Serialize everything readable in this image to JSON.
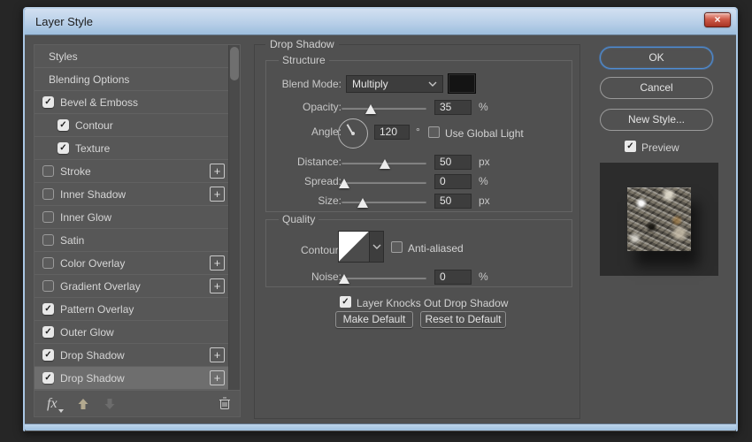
{
  "window": {
    "title": "Layer Style"
  },
  "icons": {
    "check": "✓",
    "close": "×",
    "plus": "+",
    "fx": "fx",
    "up_arrow": "move-up",
    "down_arrow": "move-down",
    "trash": "delete-effect"
  },
  "colors": {
    "accent_blue": "#4f8ed6",
    "titlebar_top": "#d2e0f1",
    "titlebar_bottom": "#9dbedd",
    "swatch_black": "#141414",
    "close_red": "#cf5c4a",
    "selected_row": "#6e6e6e"
  },
  "sidebar": {
    "items": [
      {
        "label": "Styles",
        "checked": null,
        "plus": false,
        "indent": false,
        "selected": false
      },
      {
        "label": "Blending Options",
        "checked": null,
        "plus": false,
        "indent": false,
        "selected": false
      },
      {
        "label": "Bevel & Emboss",
        "checked": true,
        "plus": false,
        "indent": false,
        "selected": false
      },
      {
        "label": "Contour",
        "checked": true,
        "plus": false,
        "indent": true,
        "selected": false
      },
      {
        "label": "Texture",
        "checked": true,
        "plus": false,
        "indent": true,
        "selected": false
      },
      {
        "label": "Stroke",
        "checked": false,
        "plus": true,
        "indent": false,
        "selected": false
      },
      {
        "label": "Inner Shadow",
        "checked": false,
        "plus": true,
        "indent": false,
        "selected": false
      },
      {
        "label": "Inner Glow",
        "checked": false,
        "plus": false,
        "indent": false,
        "selected": false
      },
      {
        "label": "Satin",
        "checked": false,
        "plus": false,
        "indent": false,
        "selected": false
      },
      {
        "label": "Color Overlay",
        "checked": false,
        "plus": true,
        "indent": false,
        "selected": false
      },
      {
        "label": "Gradient Overlay",
        "checked": false,
        "plus": true,
        "indent": false,
        "selected": false
      },
      {
        "label": "Pattern Overlay",
        "checked": true,
        "plus": false,
        "indent": false,
        "selected": false
      },
      {
        "label": "Outer Glow",
        "checked": true,
        "plus": false,
        "indent": false,
        "selected": false
      },
      {
        "label": "Drop Shadow",
        "checked": true,
        "plus": true,
        "indent": false,
        "selected": false
      },
      {
        "label": "Drop Shadow",
        "checked": true,
        "plus": true,
        "indent": false,
        "selected": true
      }
    ]
  },
  "main": {
    "panel_title": "Drop Shadow",
    "structure": {
      "legend": "Structure",
      "blend_mode": {
        "label": "Blend Mode:",
        "value": "Multiply"
      },
      "opacity": {
        "label": "Opacity:",
        "value": "35",
        "unit": "%",
        "pos": 34
      },
      "angle": {
        "label": "Angle:",
        "value": "120",
        "unit": "°"
      },
      "use_global_light": {
        "label": "Use Global Light",
        "checked": false
      },
      "distance": {
        "label": "Distance:",
        "value": "50",
        "unit": "px",
        "pos": 51
      },
      "spread": {
        "label": "Spread:",
        "value": "0",
        "unit": "%",
        "pos": 3
      },
      "size": {
        "label": "Size:",
        "value": "50",
        "unit": "px",
        "pos": 25
      }
    },
    "quality": {
      "legend": "Quality",
      "contour": {
        "label": "Contour:"
      },
      "anti_aliased": {
        "label": "Anti-aliased",
        "checked": false
      },
      "noise": {
        "label": "Noise:",
        "value": "0",
        "unit": "%",
        "pos": 3
      }
    },
    "knockout": {
      "label": "Layer Knocks Out Drop Shadow",
      "checked": true
    },
    "footer_buttons": {
      "make_default": "Make Default",
      "reset_to_default": "Reset to Default"
    }
  },
  "actions": {
    "ok": "OK",
    "cancel": "Cancel",
    "new_style": "New Style...",
    "preview": {
      "label": "Preview",
      "checked": true
    }
  }
}
